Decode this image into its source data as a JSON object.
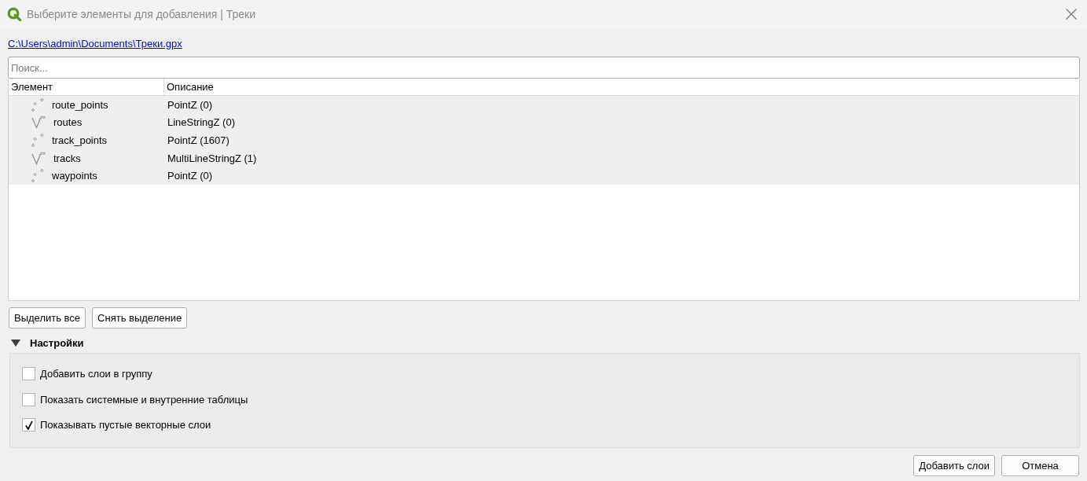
{
  "window": {
    "title": "Выберите элементы для добавления | Треки"
  },
  "file_link": "C:\\Users\\admin\\Documents\\Треки.gpx",
  "search": {
    "placeholder": "Поиск..."
  },
  "table": {
    "columns": [
      "Элемент",
      "Описание"
    ],
    "rows": [
      {
        "kind": "point",
        "name": "route_points",
        "description": "PointZ (0)",
        "selected": true
      },
      {
        "kind": "line",
        "name": "routes",
        "description": "LineStringZ (0)",
        "selected": true
      },
      {
        "kind": "point",
        "name": "track_points",
        "description": "PointZ (1607)",
        "selected": true
      },
      {
        "kind": "line",
        "name": "tracks",
        "description": "MultiLineStringZ (1)",
        "selected": true
      },
      {
        "kind": "point",
        "name": "waypoints",
        "description": "PointZ (0)",
        "selected": true
      }
    ]
  },
  "selection_buttons": [
    "Выделить все",
    "Снять выделение"
  ],
  "settings": {
    "title": "Настройки",
    "expanded": true,
    "options": [
      {
        "label": "Добавить слои в группу",
        "checked": false
      },
      {
        "label": "Показать системные и внутренние таблицы",
        "checked": false
      },
      {
        "label": "Показывать пустые векторные слои",
        "checked": true
      }
    ]
  },
  "buttons": [
    "Добавить слои",
    "Отмена"
  ]
}
